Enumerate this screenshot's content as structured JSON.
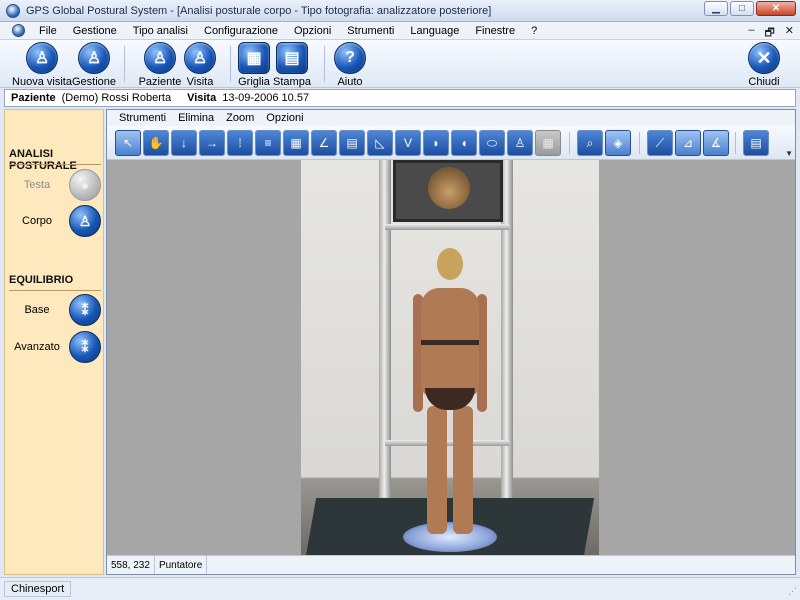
{
  "window": {
    "title": "GPS Global Postural System - [Analisi posturale corpo  -  Tipo fotografia: analizzatore posteriore]",
    "minimize": "▁",
    "maximize": "□",
    "close": "✕"
  },
  "menubar": {
    "items": [
      "File",
      "Gestione",
      "Tipo analisi",
      "Configurazione",
      "Opzioni",
      "Strumenti",
      "Language",
      "Finestre",
      "?"
    ],
    "mdi_controls": [
      "–",
      "🗗",
      "✕"
    ]
  },
  "toolbar": {
    "buttons": [
      {
        "label": "Nuova visita",
        "icon": "person-icon"
      },
      {
        "label": "Gestione",
        "icon": "person-icon"
      },
      {
        "label": "Paziente",
        "icon": "person-icon"
      },
      {
        "label": "Visita",
        "icon": "person-icon"
      },
      {
        "label": "Griglia",
        "icon": "grid-icon"
      },
      {
        "label": "Stampa",
        "icon": "print-icon"
      },
      {
        "label": "Aiuto",
        "icon": "help-icon"
      },
      {
        "label": "Chiudi",
        "icon": "close-icon"
      }
    ],
    "help_glyph": "?",
    "close_glyph": "✕"
  },
  "patient": {
    "patient_label": "Paziente",
    "patient_value": "(Demo) Rossi Roberta",
    "visit_label": "Visita",
    "visit_value": "13-09-2006 10.57"
  },
  "sidebar": {
    "section1_title": "ANALISI POSTURALE",
    "section1_items": [
      {
        "label": "Testa",
        "enabled": false
      },
      {
        "label": "Corpo",
        "enabled": true
      }
    ],
    "section2_title": "EQUILIBRIO",
    "section2_items": [
      {
        "label": "Base",
        "enabled": true
      },
      {
        "label": "Avanzato",
        "enabled": true
      }
    ]
  },
  "inner": {
    "submenu": [
      "Strumenti",
      "Elimina",
      "Zoom",
      "Opzioni"
    ],
    "tools": [
      {
        "name": "pointer-tool-icon",
        "glyph": "↖",
        "active": true
      },
      {
        "name": "hand-tool-icon",
        "glyph": "✋"
      },
      {
        "name": "vertical-line-tool-icon",
        "glyph": "↓"
      },
      {
        "name": "horizontal-line-tool-icon",
        "glyph": "→"
      },
      {
        "name": "points-tool-icon",
        "glyph": "⁞"
      },
      {
        "name": "multi-line-tool-icon",
        "glyph": "≡"
      },
      {
        "name": "ruler-tool-icon",
        "glyph": "▦"
      },
      {
        "name": "angle-tool-icon",
        "glyph": "∠"
      },
      {
        "name": "level-tool-icon",
        "glyph": "▤"
      },
      {
        "name": "triangle-tool-icon",
        "glyph": "◺"
      },
      {
        "name": "v-angle-tool-icon",
        "glyph": "V"
      },
      {
        "name": "foot-left-tool-icon",
        "glyph": "◗"
      },
      {
        "name": "foot-right-tool-icon",
        "glyph": "◖"
      },
      {
        "name": "ellipse-tool-icon",
        "glyph": "⬭"
      },
      {
        "name": "body-tool-icon",
        "glyph": "♙"
      },
      {
        "name": "grid-tool-icon",
        "glyph": "▦",
        "disabled": true
      },
      {
        "name": "zoom-tool-icon",
        "glyph": "⌕"
      },
      {
        "name": "center-tool-icon",
        "glyph": "◈",
        "active": true
      },
      {
        "name": "diagonal-tool-icon",
        "glyph": "⟋"
      },
      {
        "name": "slope-tool-icon",
        "glyph": "⊿",
        "active": true
      },
      {
        "name": "angle2-tool-icon",
        "glyph": "∡",
        "active": true
      },
      {
        "name": "report-tool-icon",
        "glyph": "▤"
      }
    ],
    "more": "▼",
    "coords": "558, 232",
    "mode": "Puntatore"
  },
  "statusbar": {
    "company": "Chinesport"
  }
}
